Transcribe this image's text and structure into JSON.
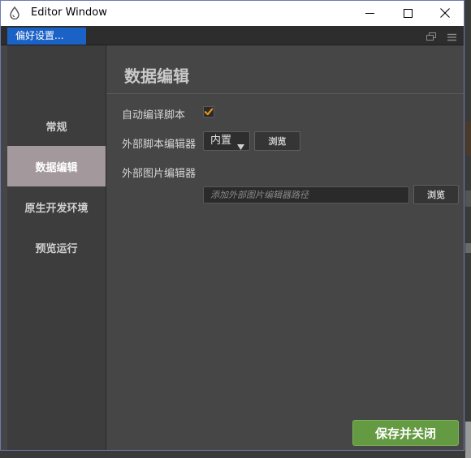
{
  "window": {
    "title": "Editor Window",
    "tab_label": "偏好设置..."
  },
  "sidebar": {
    "items": [
      {
        "label": "常规",
        "active": false
      },
      {
        "label": "数据编辑",
        "active": true
      },
      {
        "label": "原生开发环境",
        "active": false
      },
      {
        "label": "预览运行",
        "active": false
      }
    ]
  },
  "main": {
    "section_title": "数据编辑",
    "auto_compile": {
      "label": "自动编译脚本",
      "checked": true
    },
    "script_editor": {
      "label": "外部脚本编辑器",
      "value": "内置",
      "browse_label": "浏览"
    },
    "image_editor": {
      "label": "外部图片编辑器",
      "placeholder": "添加外部图片编辑器路径",
      "value": "",
      "browse_label": "浏览"
    }
  },
  "footer": {
    "save_label": "保存并关闭"
  },
  "icons": {
    "app": "app-drop-icon",
    "minimize": "minimize-icon",
    "maximize": "maximize-icon",
    "close": "close-icon",
    "popout": "popout-icon",
    "menu": "hamburger-menu-icon",
    "check": "check-icon",
    "dropdown": "dropdown-arrow-icon"
  },
  "colors": {
    "accent_tab": "#1b62c6",
    "active_sidebar": "#a3989b",
    "checkbox_mark": "#e8931e",
    "save_button": "#639a42"
  }
}
